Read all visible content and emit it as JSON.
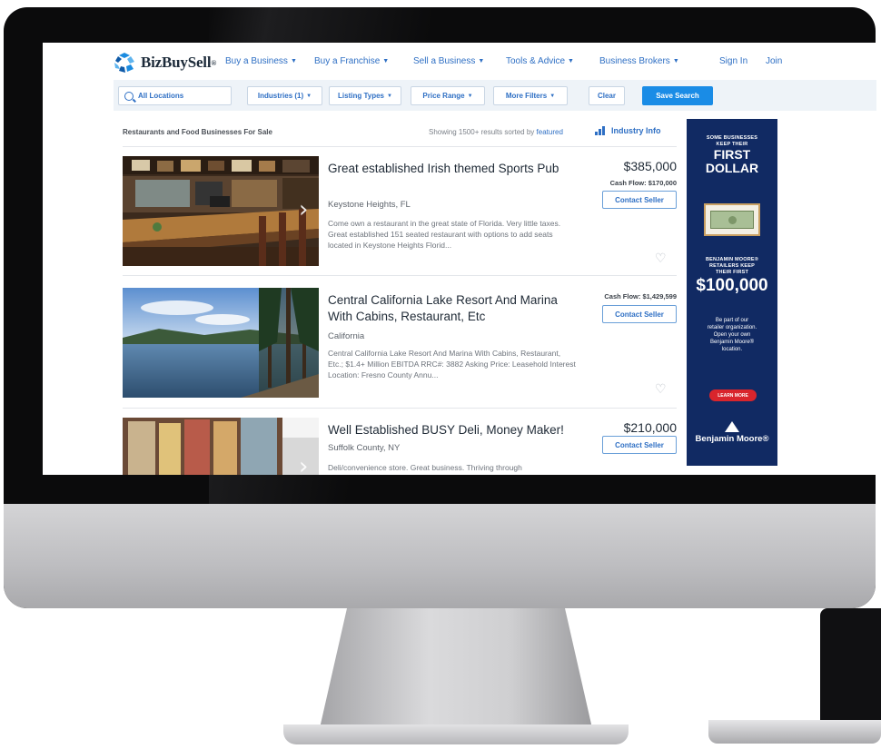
{
  "brand": {
    "name": "BizBuySell",
    "trademark": "®",
    "colors": {
      "primary": "#2e6fc4",
      "accent": "#1a8ce6",
      "ad_background": "#112a63"
    }
  },
  "nav": {
    "items": [
      {
        "label": "Buy a Business",
        "has_dropdown": true
      },
      {
        "label": "Buy a Franchise",
        "has_dropdown": true
      },
      {
        "label": "Sell a Business",
        "has_dropdown": true
      },
      {
        "label": "Tools & Advice",
        "has_dropdown": true
      },
      {
        "label": "Business Brokers",
        "has_dropdown": true
      }
    ],
    "sign_in": "Sign In",
    "join": "Join"
  },
  "filters": {
    "location_placeholder": "All Locations",
    "industries": "Industries (1)",
    "listing_types": "Listing Types",
    "price_range": "Price Range",
    "more_filters": "More Filters",
    "clear": "Clear",
    "save_search": "Save Search"
  },
  "results": {
    "heading": "Restaurants and Food Businesses For Sale",
    "showing_prefix": "Showing 1500+ results sorted by",
    "sort_value": "featured",
    "industry_info": "Industry Info"
  },
  "listings": [
    {
      "title": "Great established Irish themed Sports Pub",
      "location": "Keystone Heights, FL",
      "description": "Come own a restaurant in the great state of Florida. Very little taxes. Great established 151 seated restaurant with options to add seats located in Keystone Heights Florid...",
      "price": "$385,000",
      "cash_flow": "Cash Flow: $170,000",
      "contact": "Contact Seller"
    },
    {
      "title": "Central California Lake Resort And Marina With Cabins, Restaurant, Etc",
      "location": "California",
      "description": "Central California Lake Resort And Marina With Cabins, Restaurant, Etc.; $1.4+ Million EBITDA RRC#: 3882 Asking Price: Leasehold Interest Location: Fresno County Annu...",
      "price": "",
      "cash_flow": "Cash Flow: $1,429,599",
      "contact": "Contact Seller"
    },
    {
      "title": "Well Established BUSY Deli, Money Maker!",
      "location": "Suffolk County, NY",
      "description": "Deli/convenience store. Great business. Thriving through",
      "price": "$210,000",
      "cash_flow": "",
      "contact": "Contact Seller"
    }
  ],
  "ad": {
    "line1": "SOME BUSINESSES",
    "line2": "KEEP THEIR",
    "headline1": "FIRST",
    "headline2": "DOLLAR",
    "line3": "BENJAMIN MOORE®",
    "line4": "RETAILERS KEEP",
    "line5": "THEIR FIRST",
    "amount": "$100,000",
    "body1": "Be part of our",
    "body2": "retailer organization.",
    "body3": "Open your own",
    "body4": "Benjamin Moore®",
    "body5": "location.",
    "cta": "LEARN MORE",
    "advertiser": "Benjamin Moore®"
  }
}
